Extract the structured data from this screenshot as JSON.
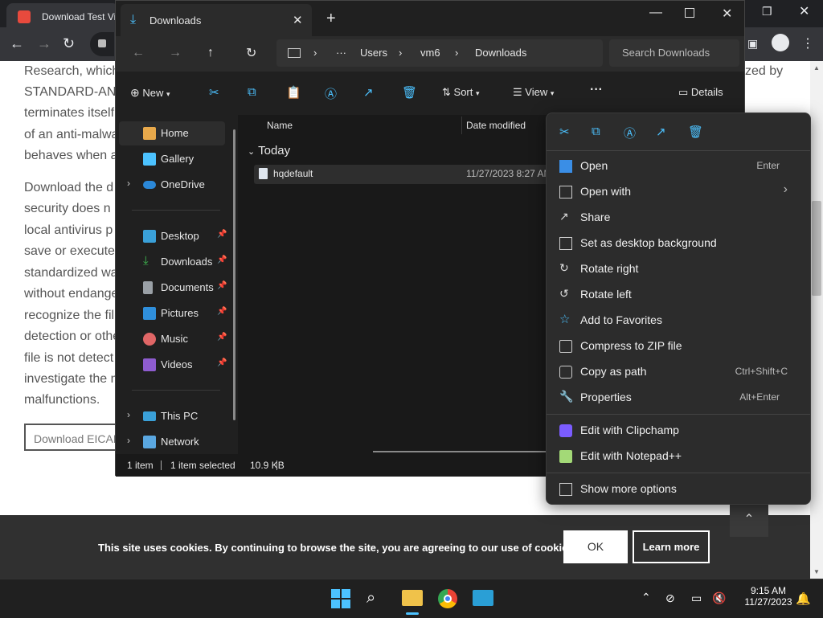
{
  "browser": {
    "tab_title": "Download Test Viru",
    "website_lines": [
      "Research, which",
      "STANDARD-AN",
      "terminates itself",
      "of an anti-malwa",
      "behaves when a",
      "Download the d",
      "security does n",
      "local antivirus p",
      "save or execute",
      "standardized wa",
      "without endange",
      "recognize the fil",
      "detection or othe",
      "file is not detect",
      "investigate the m",
      "malfunctions."
    ],
    "website_right_fragment": "zed by",
    "download_button": "Download EICAR",
    "cookie_text": "This site uses cookies. By continuing to browse the site, you are agreeing to our use of cookies.",
    "cookie_ok": "OK",
    "cookie_learn_more": "Learn more"
  },
  "explorer": {
    "tab_title": "Downloads",
    "breadcrumb": [
      "Users",
      "vm6",
      "Downloads"
    ],
    "breadcrumb_more": "···",
    "search_placeholder": "Search Downloads",
    "cmd": {
      "new": "New",
      "sort": "Sort",
      "view": "View",
      "more": "···",
      "details": "Details"
    },
    "sidebar": {
      "home": "Home",
      "gallery": "Gallery",
      "onedrive": "OneDrive",
      "quick": [
        "Desktop",
        "Downloads",
        "Documents",
        "Pictures",
        "Music",
        "Videos"
      ],
      "this_pc": "This PC",
      "network": "Network"
    },
    "columns": {
      "name": "Name",
      "date": "Date modified"
    },
    "group": "Today",
    "file": {
      "name": "hqdefault",
      "date": "11/27/2023 8:27 AM"
    },
    "status": {
      "count": "1 item",
      "selected": "1 item selected",
      "size": "10.9 KB"
    }
  },
  "context_menu": {
    "items": [
      {
        "label": "Open",
        "shortcut": "Enter"
      },
      {
        "label": "Open with",
        "shortcut": "›"
      },
      {
        "label": "Share",
        "shortcut": ""
      },
      {
        "label": "Set as desktop background",
        "shortcut": ""
      },
      {
        "label": "Rotate right",
        "shortcut": ""
      },
      {
        "label": "Rotate left",
        "shortcut": ""
      },
      {
        "label": "Add to Favorites",
        "shortcut": ""
      },
      {
        "label": "Compress to ZIP file",
        "shortcut": ""
      },
      {
        "label": "Copy as path",
        "shortcut": "Ctrl+Shift+C"
      },
      {
        "label": "Properties",
        "shortcut": "Alt+Enter"
      }
    ],
    "apps": [
      {
        "label": "Edit with Clipchamp"
      },
      {
        "label": "Edit with Notepad++"
      }
    ],
    "more": "Show more options"
  },
  "taskbar": {
    "time": "9:15 AM",
    "date": "11/27/2023"
  }
}
